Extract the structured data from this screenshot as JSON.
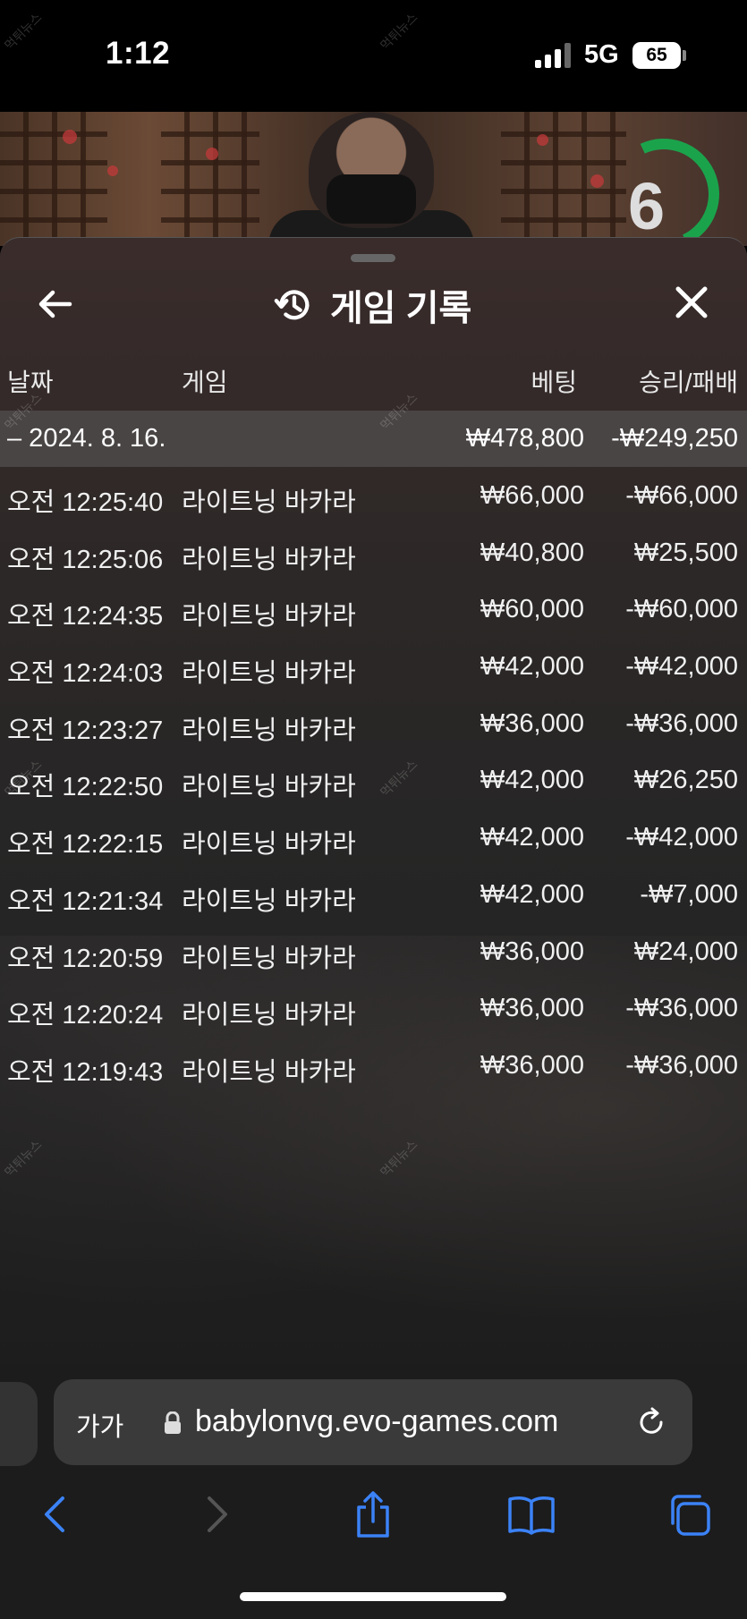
{
  "status_bar": {
    "time": "1:12",
    "network": "5G",
    "battery": "65"
  },
  "video": {
    "timer_value": "6"
  },
  "panel": {
    "title": "게임 기록",
    "columns": {
      "date": "날짜",
      "game": "게임",
      "bet": "베팅",
      "result": "승리/패배"
    },
    "day_summary": {
      "date": "– 2024. 8. 16.",
      "bet": "₩478,800",
      "result": "-₩249,250"
    },
    "rows": [
      {
        "time": "오전 12:25:40",
        "game": "라이트닝 바카라",
        "bet": "₩66,000",
        "result": "-₩66,000"
      },
      {
        "time": "오전 12:25:06",
        "game": "라이트닝 바카라",
        "bet": "₩40,800",
        "result": "₩25,500"
      },
      {
        "time": "오전 12:24:35",
        "game": "라이트닝 바카라",
        "bet": "₩60,000",
        "result": "-₩60,000"
      },
      {
        "time": "오전 12:24:03",
        "game": "라이트닝 바카라",
        "bet": "₩42,000",
        "result": "-₩42,000"
      },
      {
        "time": "오전 12:23:27",
        "game": "라이트닝 바카라",
        "bet": "₩36,000",
        "result": "-₩36,000"
      },
      {
        "time": "오전 12:22:50",
        "game": "라이트닝 바카라",
        "bet": "₩42,000",
        "result": "₩26,250"
      },
      {
        "time": "오전 12:22:15",
        "game": "라이트닝 바카라",
        "bet": "₩42,000",
        "result": "-₩42,000"
      },
      {
        "time": "오전 12:21:34",
        "game": "라이트닝 바카라",
        "bet": "₩42,000",
        "result": "-₩7,000"
      },
      {
        "time": "오전 12:20:59",
        "game": "라이트닝 바카라",
        "bet": "₩36,000",
        "result": "₩24,000"
      },
      {
        "time": "오전 12:20:24",
        "game": "라이트닝 바카라",
        "bet": "₩36,000",
        "result": "-₩36,000"
      },
      {
        "time": "오전 12:19:43",
        "game": "라이트닝 바카라",
        "bet": "₩36,000",
        "result": "-₩36,000"
      }
    ]
  },
  "browser": {
    "font_size_label": "가가",
    "url": "babylonvg.evo-games.com",
    "accent_color": "#3b82f6"
  },
  "watermark": "먹튀뉴스"
}
